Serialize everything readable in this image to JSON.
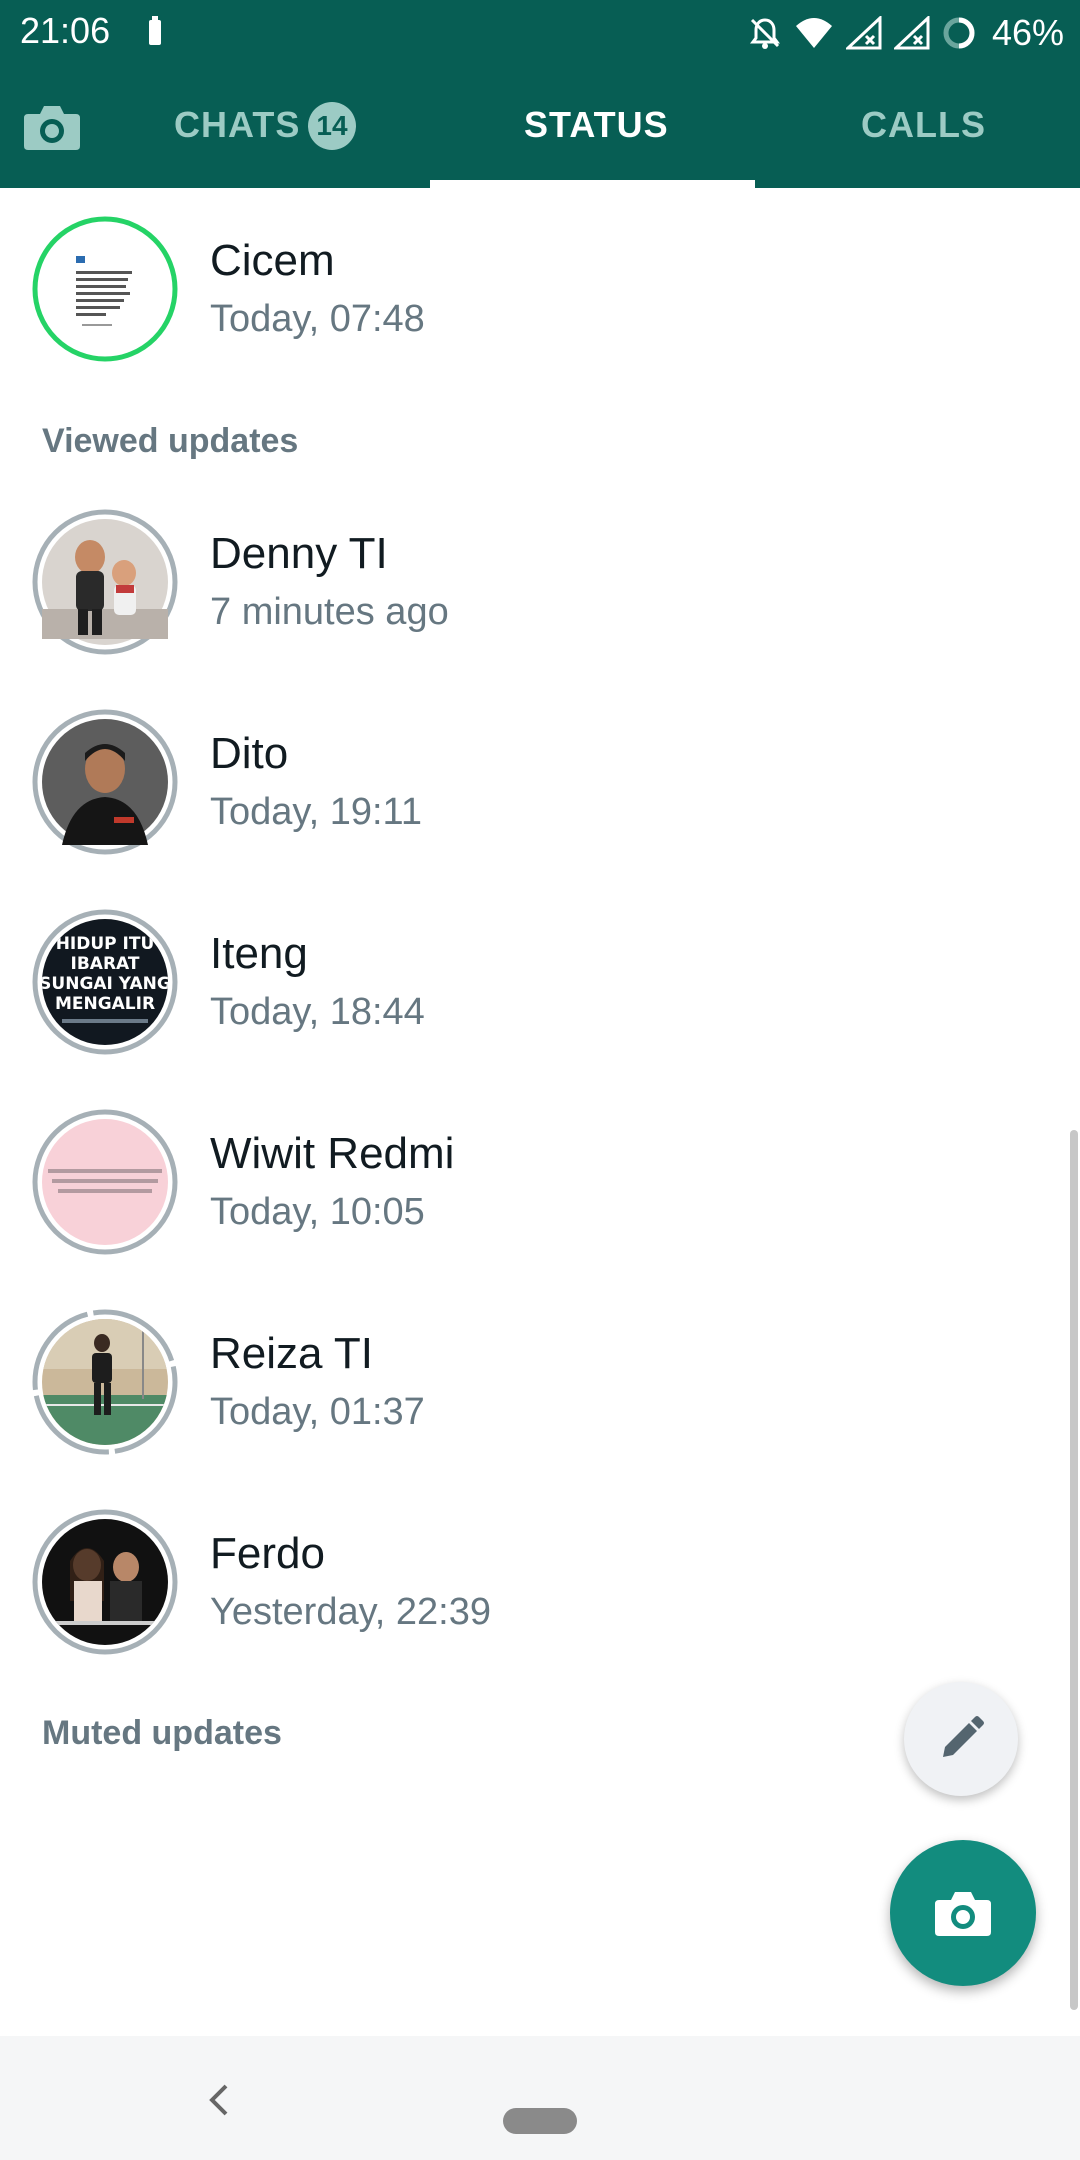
{
  "status_bar": {
    "time": "21:06",
    "battery_percent": "46%",
    "icons": [
      "battery-small-icon",
      "bell-off-icon",
      "wifi-icon",
      "signal-x-icon",
      "signal-x-icon",
      "loading-ring-icon"
    ]
  },
  "tabs": {
    "camera_icon": "camera-icon",
    "items": [
      {
        "label": "CHATS",
        "badge": "14",
        "active": false
      },
      {
        "label": "STATUS",
        "active": true
      },
      {
        "label": "CALLS",
        "active": false
      }
    ]
  },
  "recent": [
    {
      "name": "Cicem",
      "time": "Today, 07:48",
      "ring": "unviewed"
    }
  ],
  "viewed_header": "Viewed updates",
  "viewed": [
    {
      "name": "Denny TI",
      "time": "7 minutes ago"
    },
    {
      "name": "Dito",
      "time": "Today, 19:11"
    },
    {
      "name": "Iteng",
      "time": "Today, 18:44",
      "thumb_text": "HIDUP ITU IBARAT SUNGAI YANG MENGALIR"
    },
    {
      "name": "Wiwit Redmi",
      "time": "Today, 10:05"
    },
    {
      "name": "Reiza TI",
      "time": "Today, 01:37"
    },
    {
      "name": "Ferdo",
      "time": "Yesterday, 22:39"
    }
  ],
  "muted_header": "Muted updates",
  "fabs": {
    "pencil_icon": "pencil-icon",
    "camera_icon": "camera-icon"
  },
  "nav": {
    "back_icon": "back-chevron-icon",
    "home_icon": "home-pill-icon"
  },
  "colors": {
    "header": "#075e54",
    "accent": "#128c7e",
    "ring_unviewed": "#25d366",
    "ring_viewed": "#a6b0b6"
  }
}
